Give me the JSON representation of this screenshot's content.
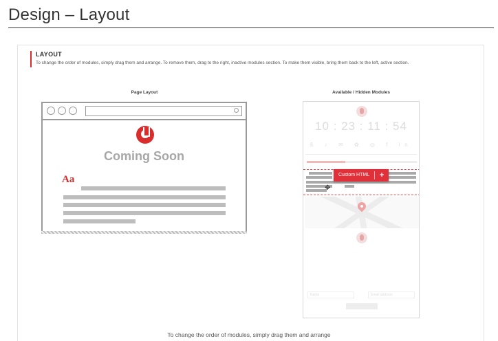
{
  "page": {
    "title": "Design – Layout"
  },
  "intro": {
    "heading": "LAYOUT",
    "text": "To change the order of modules, simply drag them and arrange. To remove them, drag to the right, inactive modules section. To make them visible, bring them back to the left, active section."
  },
  "page_layout": {
    "label": "Page Layout",
    "coming_soon": "Coming Soon",
    "typography_sample": "Aa"
  },
  "modules": {
    "label": "Available / Hidden Modules",
    "countdown": "10 : 23 : 11 : 54",
    "social_icons": "& ♪ ✉ ✿ ◎ f in",
    "progress_fraction": 0.35,
    "custom_html_label": "Custom HTML",
    "add_label": "+",
    "cursor": "✥",
    "input_1": "Name",
    "input_2": "Email address"
  },
  "caption": "To change the order of modules, simply drag them and arrange",
  "colors": {
    "accent": "#e0313b",
    "text_gray": "#a7a7a7"
  }
}
